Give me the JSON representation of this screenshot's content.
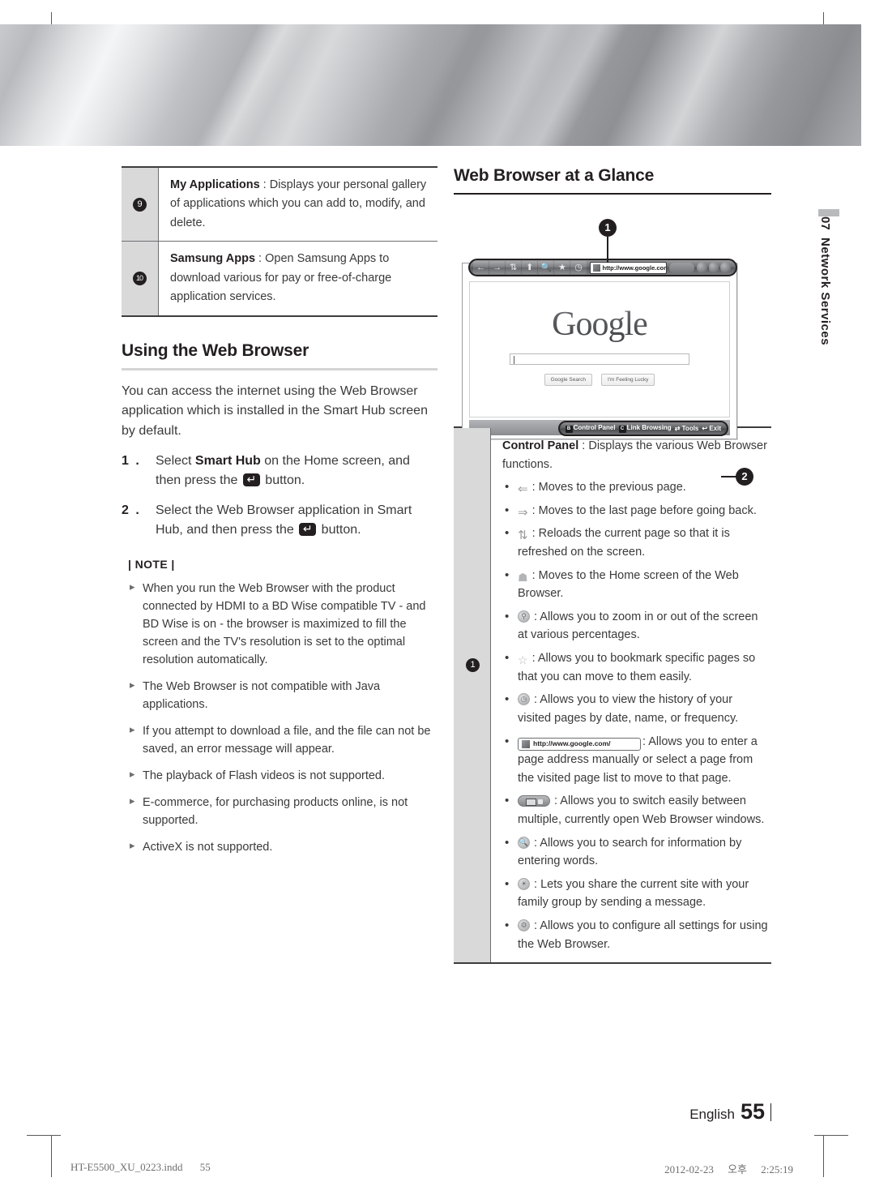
{
  "document": {
    "chapter_number": "07",
    "chapter_title": "Network Services",
    "language": "English",
    "page_number": "55"
  },
  "print_info": {
    "filename": "HT-E5500_XU_0223.indd",
    "page": "55",
    "date": "2012-02-23",
    "time_prefix": "오후",
    "time": "2:25:19"
  },
  "item_table": {
    "rows": [
      {
        "number": "9",
        "title": "My Applications",
        "separator": ":",
        "text": "Displays your personal gallery of applications which you can add to, modify, and delete."
      },
      {
        "number": "10",
        "title": "Samsung Apps",
        "separator": ":",
        "text": "Open Samsung Apps to download various for pay or free-of-charge application services."
      }
    ]
  },
  "using_section": {
    "heading": "Using the Web Browser",
    "intro": "You can access the internet using the Web Browser application which is installed in the Smart Hub screen by default.",
    "steps": [
      {
        "number": "1 .",
        "before": "Select ",
        "bold": "Smart Hub",
        "after": " on the Home screen, and then press the ",
        "tail": " button."
      },
      {
        "number": "2 .",
        "before": "Select the Web Browser application in Smart Hub, and then press the ",
        "bold": "",
        "after": "",
        "tail": " button."
      }
    ],
    "note_heading": "| NOTE |",
    "notes": [
      "When you run the Web Browser with the product connected by HDMI to a BD Wise compatible TV - and BD Wise is on - the browser is maximized to fill the screen and the TV's resolution is set to the optimal resolution automatically.",
      "The Web Browser is not compatible with Java applications.",
      "If you attempt to download a file, and the file can not be saved, an error message will appear.",
      "The playback of Flash videos is not supported.",
      "E-commerce, for purchasing products online, is not supported.",
      "ActiveX is not supported."
    ]
  },
  "glance_section": {
    "heading": "Web Browser at a Glance",
    "callout_1": "1",
    "callout_2": "2",
    "browser": {
      "url": "http://www.google.com/",
      "logo_text": "Google",
      "search_value": "",
      "buttons": [
        "Google Search",
        "I'm Feeling Lucky"
      ],
      "status_hint": [
        {
          "key": "B",
          "label": "Control Panel"
        },
        {
          "key": "C",
          "label": "Link Browsing"
        },
        {
          "key": "⇄",
          "label": "Tools"
        },
        {
          "key": "↩",
          "label": "Exit"
        }
      ]
    }
  },
  "desc_table": {
    "number": "1",
    "lead_title": "Control Panel",
    "lead_separator": ":",
    "lead_text": "Displays the various Web Browser functions.",
    "bullets": [
      {
        "icon": "back-arrow-icon",
        "text": ": Moves to the previous page."
      },
      {
        "icon": "forward-arrow-icon",
        "text": ": Moves to the last page before going back."
      },
      {
        "icon": "reload-icon",
        "text": ": Reloads the current page so that it is refreshed on the screen."
      },
      {
        "icon": "home-icon",
        "text": ": Moves to the Home screen of the Web Browser."
      },
      {
        "icon": "zoom-icon",
        "text": ": Allows you to zoom in or out of the screen at various percentages."
      },
      {
        "icon": "bookmark-star-icon",
        "text": ": Allows you to bookmark specific pages so that you can move to them easily."
      },
      {
        "icon": "history-clock-icon",
        "text": ": Allows you to view the history of your visited pages by date, name, or frequency."
      },
      {
        "icon": "url-bar-icon",
        "url": "http://www.google.com/",
        "text": ": Allows you to enter a page address manually or select a page from the visited page list to move to that page."
      },
      {
        "icon": "window-switch-icon",
        "text": ": Allows you to switch easily between multiple, currently open Web Browser windows."
      },
      {
        "icon": "search-icon",
        "text": ": Allows you to search for information by entering words."
      },
      {
        "icon": "share-icon",
        "text": ": Lets you share the current site with your family group by sending a message."
      },
      {
        "icon": "settings-gear-icon",
        "text": ": Allows you to configure all settings for using the Web Browser."
      }
    ]
  },
  "colors": {
    "ink": "#231f20",
    "body_text": "#3a3a3c",
    "rule": "#3d3d3f",
    "cell_bg": "#d9d9da"
  }
}
